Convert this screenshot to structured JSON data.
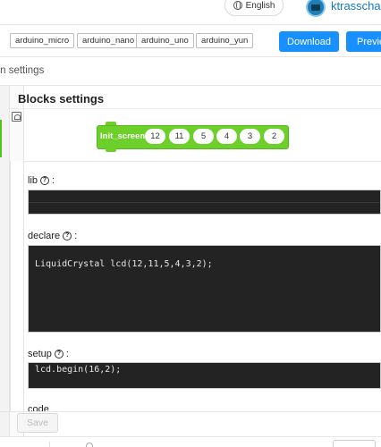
{
  "header": {
    "language_label": "English",
    "username": "ktrasschaert"
  },
  "boards": {
    "tags": [
      "arduino_micro",
      "arduino_nano",
      "arduino_uno",
      "arduino_yun"
    ],
    "download_label": "Download",
    "preview_label": "Preview"
  },
  "section": {
    "title": "Extension settings",
    "blocks_settings_title": "Blocks settings"
  },
  "block": {
    "label": "Init_screen",
    "params": [
      "12",
      "11",
      "5",
      "4",
      "3",
      "2"
    ],
    "color": "#6ccf2a"
  },
  "form": {
    "lib_label": "lib",
    "declare_label": "declare",
    "declare_code": "LiquidCrystal lcd(12,11,5,4,3,2);",
    "setup_label": "setup",
    "setup_code": "lcd.begin(16,2);",
    "code_label": "code",
    "help_icon_glyph": "?"
  },
  "footer": {
    "save_label": "Save"
  },
  "colors": {
    "primary": "#1890ff",
    "editor_bg": "#232323"
  }
}
